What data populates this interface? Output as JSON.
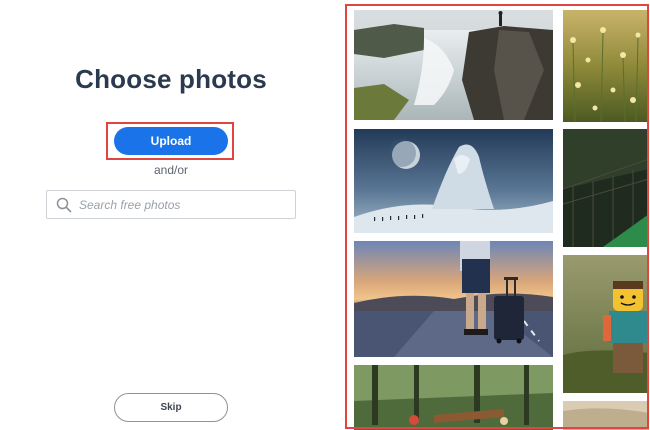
{
  "left_panel": {
    "title": "Choose photos",
    "upload_label": "Upload",
    "andor_label": "and/or",
    "search": {
      "placeholder": "Search free photos",
      "value": ""
    },
    "skip_label": "Skip"
  },
  "photo_grid": {
    "photos": [
      {
        "subject": "waterfall-cliff"
      },
      {
        "subject": "wildflower-field"
      },
      {
        "subject": "fantasy-ice-figure"
      },
      {
        "subject": "dark-forest-bridge"
      },
      {
        "subject": "traveler-with-suitcase"
      },
      {
        "subject": "lego-explorer-figure"
      },
      {
        "subject": "forest-picnic"
      },
      {
        "subject": "partial-bottom-right"
      }
    ]
  },
  "colors": {
    "accent": "#1a73e8",
    "highlight": "#e0463f",
    "title_text": "#2b3a4e"
  }
}
